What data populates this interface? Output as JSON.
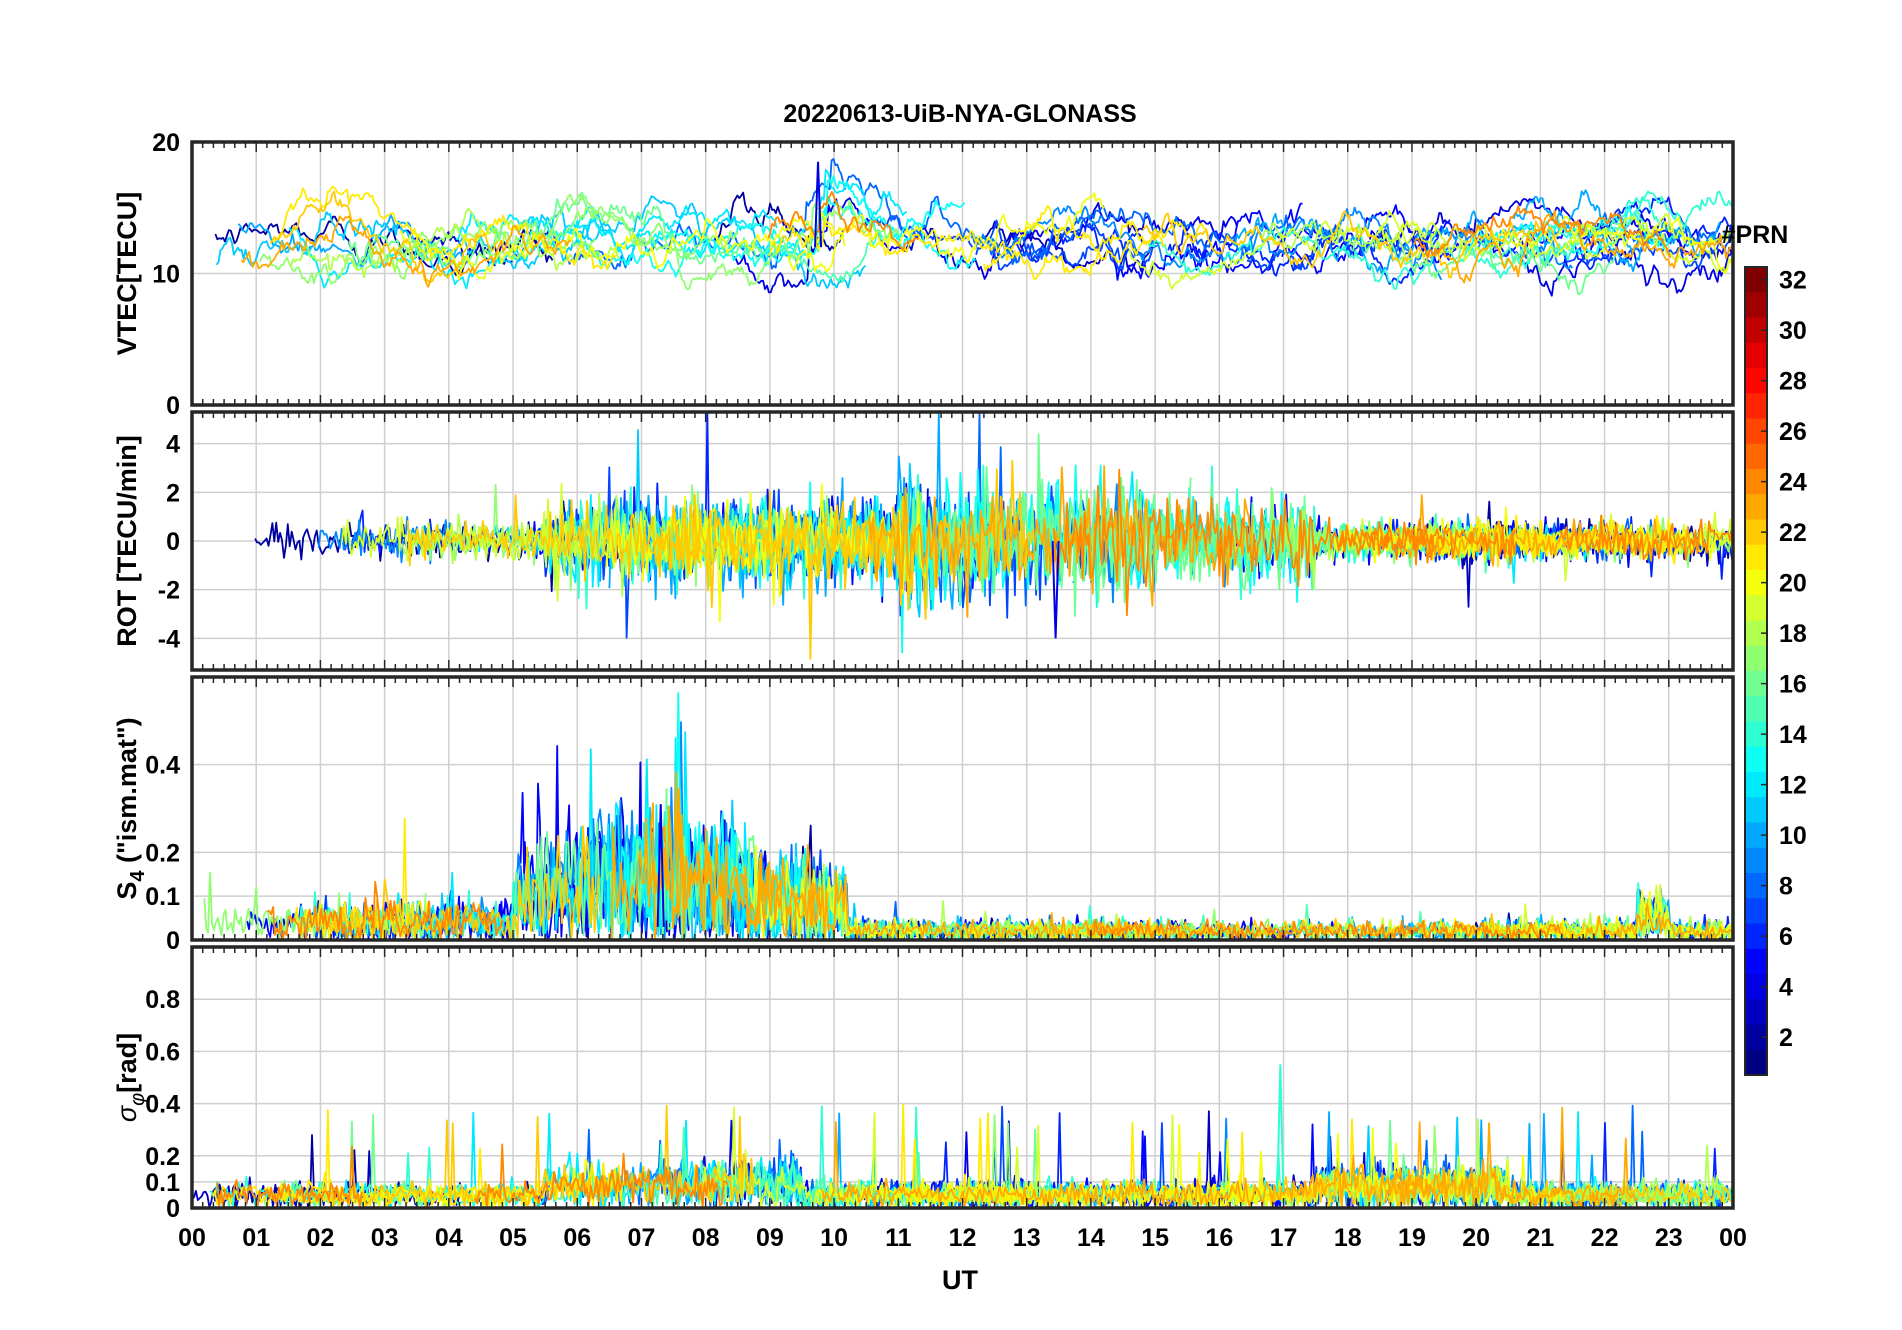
{
  "chart_data": {
    "title": "20220613-UiB-NYA-GLONASS",
    "type": "line",
    "x_axis": {
      "label": "UT",
      "unit": "hour of day",
      "range": [
        0,
        24
      ],
      "tick_labels": [
        "00",
        "01",
        "02",
        "03",
        "04",
        "05",
        "06",
        "07",
        "08",
        "09",
        "10",
        "11",
        "12",
        "13",
        "14",
        "15",
        "16",
        "17",
        "18",
        "19",
        "20",
        "21",
        "22",
        "23",
        "00"
      ]
    },
    "grid": true,
    "colorbar": {
      "label": "#PRN",
      "range": [
        1,
        32
      ],
      "colormap": "jet",
      "tick_labels": [
        "2",
        "4",
        "6",
        "8",
        "10",
        "12",
        "14",
        "16",
        "18",
        "20",
        "22",
        "24",
        "26",
        "28",
        "30",
        "32"
      ],
      "placement": "right"
    },
    "series_prn": [
      2,
      3,
      4,
      5,
      6,
      7,
      8,
      9,
      10,
      11,
      12,
      13,
      14,
      15,
      16,
      17,
      18,
      19,
      20,
      21,
      22,
      23,
      24
    ],
    "panels": [
      {
        "key": "vtec",
        "ylabel": "VTEC[TECU]",
        "ylim": [
          0,
          20
        ],
        "yticks": [
          0,
          10,
          20
        ],
        "tick_labels": [
          "0",
          "10",
          "20"
        ],
        "baseline": 12,
        "typical_range": [
          7,
          18.5
        ],
        "peak": {
          "x": 9.75,
          "y": 18.5
        }
      },
      {
        "key": "rot",
        "ylabel": "ROT [TECU/min]",
        "ylim": [
          -5.3,
          5.3
        ],
        "yticks": [
          -4,
          -2,
          0,
          2,
          4
        ],
        "tick_labels": [
          "-4",
          "-2",
          "0",
          "2",
          "4"
        ],
        "baseline": 0,
        "typical_range": [
          -4,
          3.8
        ],
        "peak": {
          "x": 13.45,
          "y": -4.0
        }
      },
      {
        "key": "s4",
        "ylabel": "S4 (\"ism.mat\")",
        "ylabel_main": "S",
        "ylabel_sub": "4",
        "ylabel_rest": "  (\"ism.mat\")",
        "ylim": [
          0,
          0.6
        ],
        "yticks": [
          0,
          0.1,
          0.2,
          0.4
        ],
        "tick_labels": [
          "0",
          "0.1",
          "0.2",
          "0.4"
        ],
        "baseline": 0.03,
        "typical_range": [
          0,
          0.32
        ],
        "peak": {
          "x": 7.3,
          "y": 0.31
        }
      },
      {
        "key": "sigma",
        "ylabel": "σφ[rad]",
        "ylabel_main": "σ",
        "ylabel_sub": "φ",
        "ylabel_rest": "[rad]",
        "ylim": [
          0,
          1
        ],
        "yticks": [
          0,
          0.1,
          0.2,
          0.4,
          0.6,
          0.8
        ],
        "tick_labels": [
          "0",
          "0.1",
          "0.2",
          "0.4",
          "0.6",
          "0.8"
        ],
        "baseline": 0.06,
        "typical_range": [
          0,
          0.55
        ],
        "peak": {
          "x": 16.95,
          "y": 0.55
        }
      }
    ]
  }
}
